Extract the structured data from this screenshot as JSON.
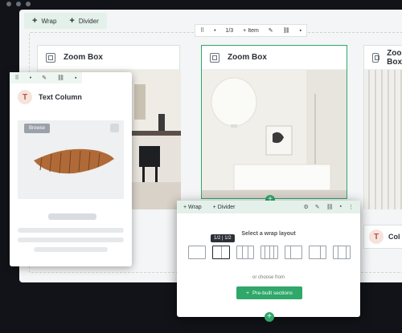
{
  "window": {
    "dots": 3
  },
  "toolbar_top": {
    "wrap_label": "Wrap",
    "divider_label": "Divider"
  },
  "item_toolbar": {
    "counter": "1/3",
    "item_label": "Item"
  },
  "zoom_boxes": [
    {
      "label": "Zoom Box"
    },
    {
      "label": "Zoom Box"
    },
    {
      "label": "Zoom Box"
    }
  ],
  "text_column": {
    "avatar_letter": "T",
    "title": "Text Column",
    "browse_label": "Browse"
  },
  "right_card2": {
    "avatar_letter": "T",
    "title": "Col"
  },
  "wrap_panel": {
    "wrap_label": "Wrap",
    "divider_label": "Divider",
    "title": "Select a wrap layout",
    "tooltip": "1/2 | 1/2",
    "choose_text": "or choose from",
    "prebuilt_label": "Pre-built sections"
  },
  "colors": {
    "accent": "#2fa86a",
    "toolbar_bg": "#e4f1ea",
    "dark": "#111318"
  }
}
